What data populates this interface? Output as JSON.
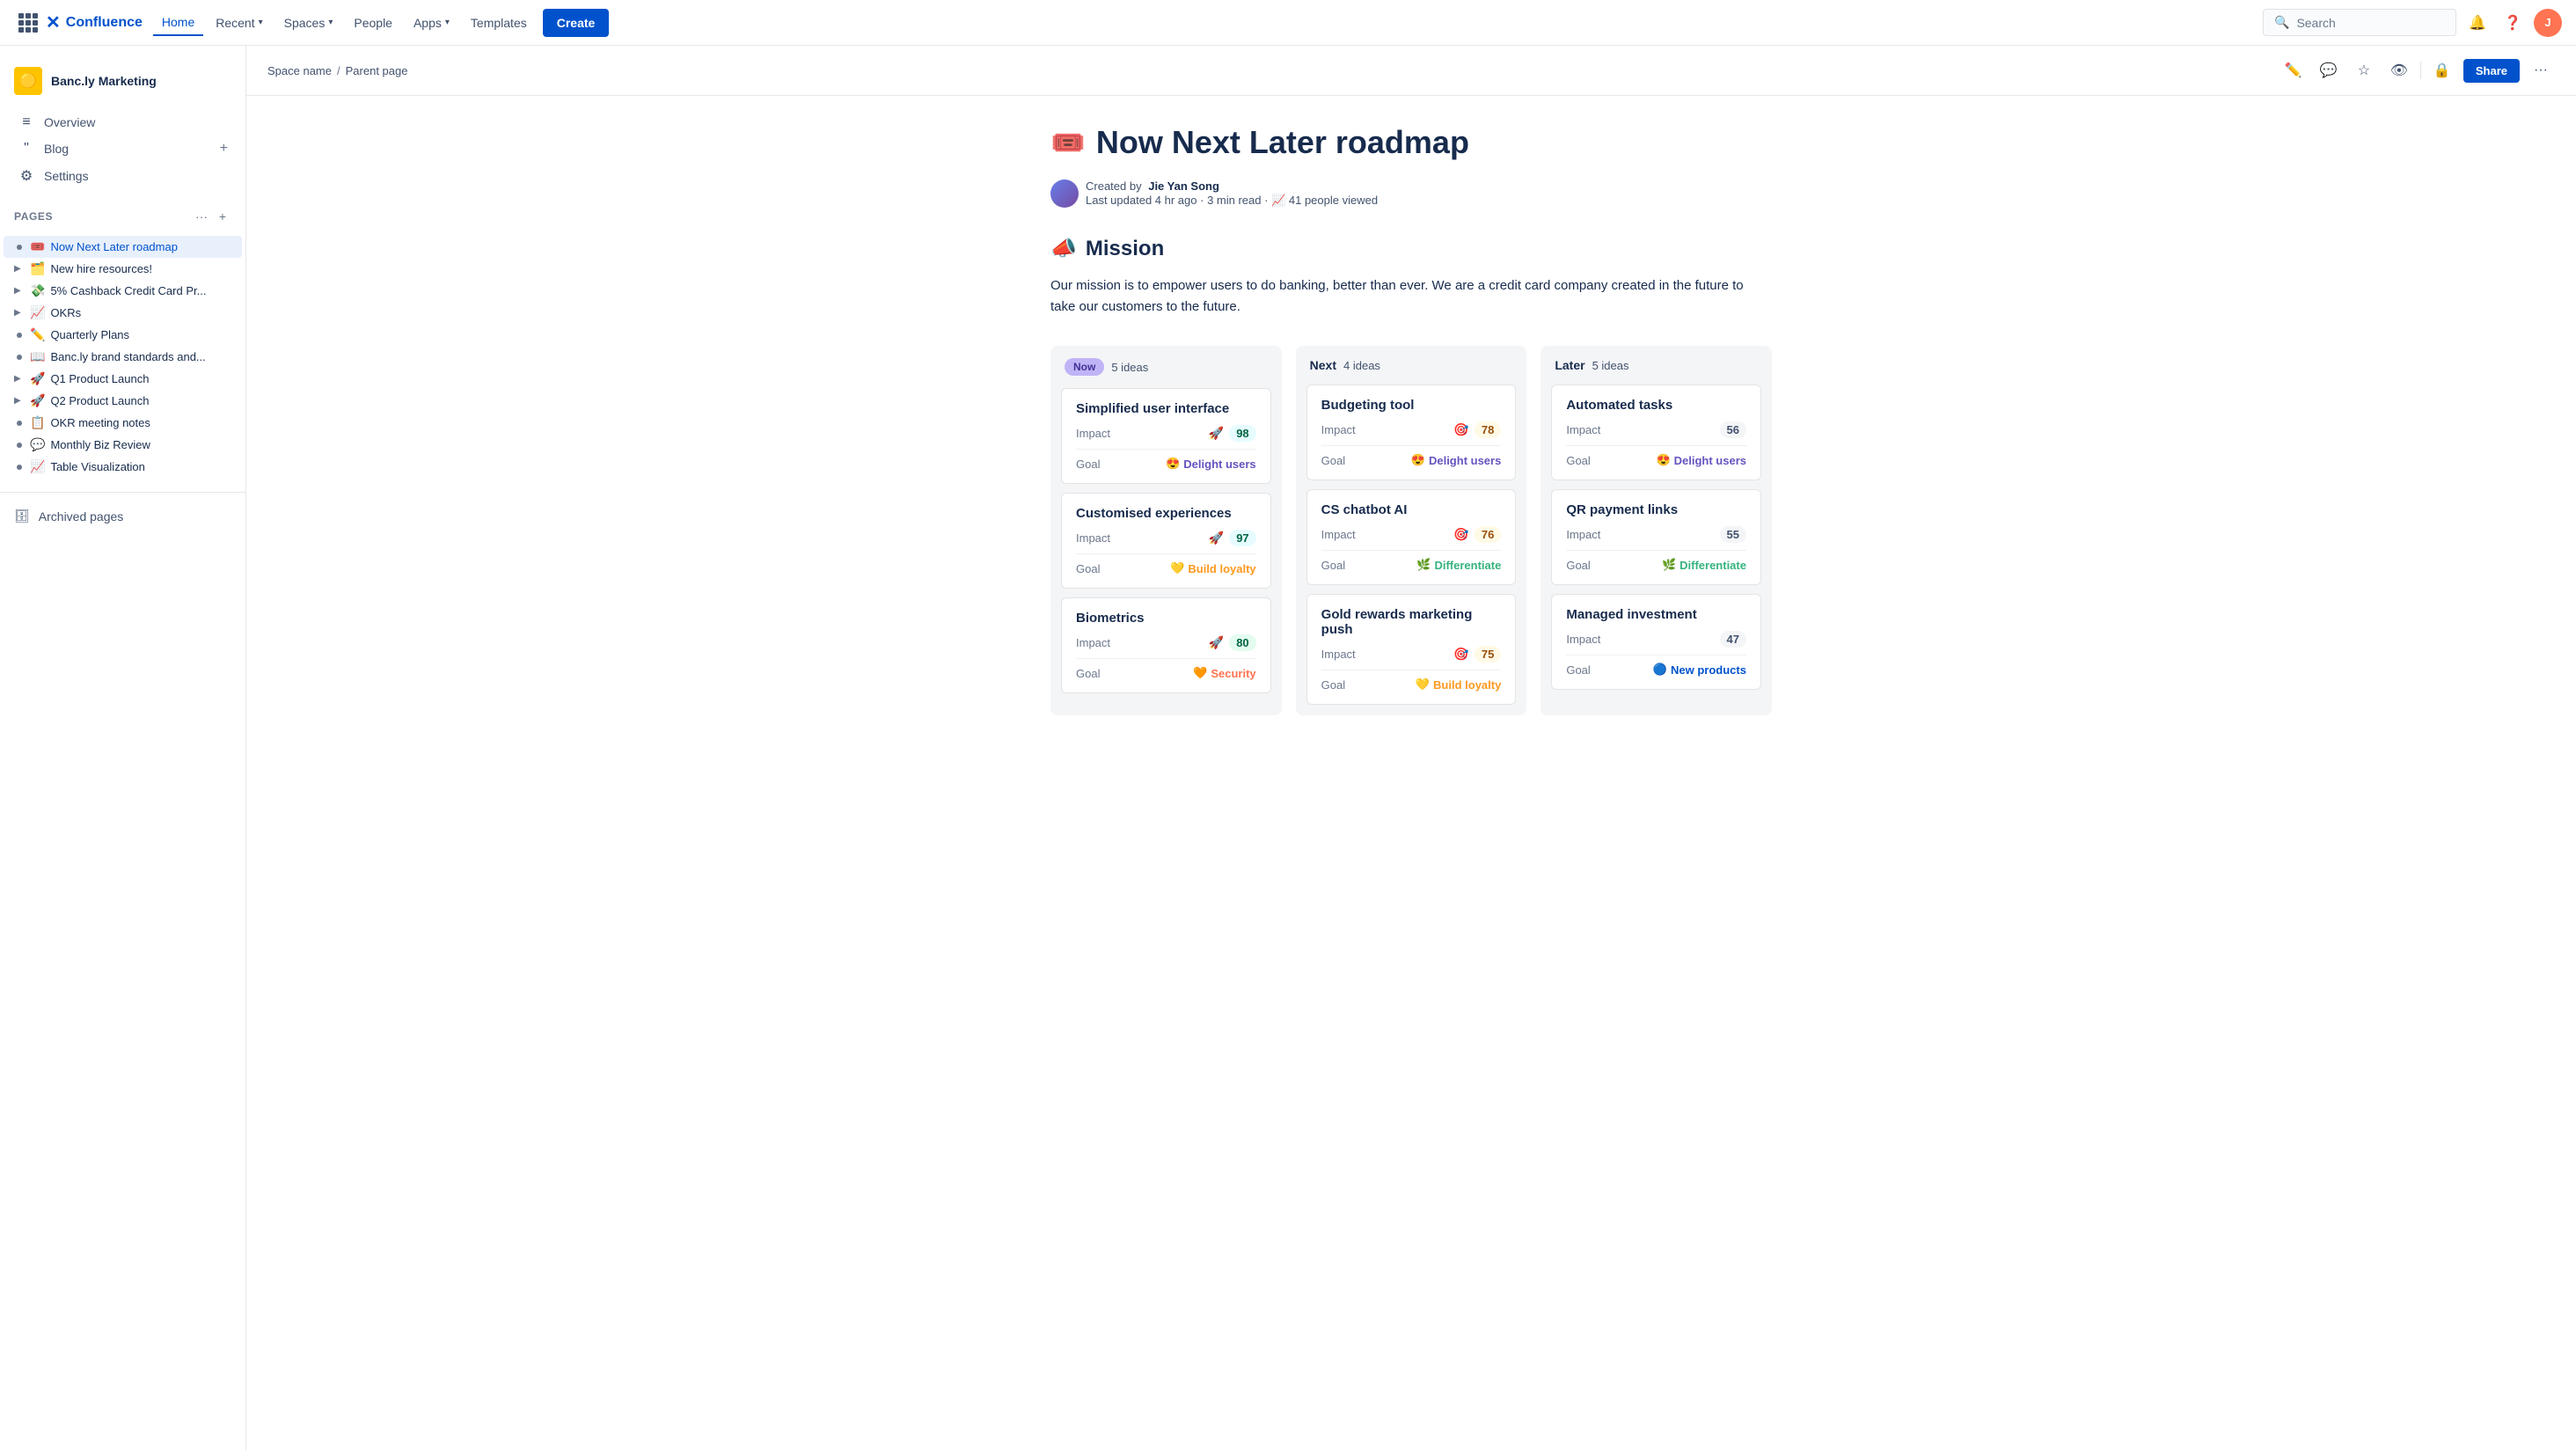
{
  "topnav": {
    "logo_text": "Confluence",
    "home_label": "Home",
    "recent_label": "Recent",
    "spaces_label": "Spaces",
    "people_label": "People",
    "apps_label": "Apps",
    "templates_label": "Templates",
    "create_label": "Create",
    "search_placeholder": "Search"
  },
  "sidebar": {
    "space_name": "Banc.ly Marketing",
    "space_emoji": "🟡",
    "nav": [
      {
        "label": "Overview",
        "icon": "≡"
      },
      {
        "label": "Blog",
        "icon": "❝"
      },
      {
        "label": "Settings",
        "icon": "⚙"
      }
    ],
    "pages_section": "Pages",
    "pages": [
      {
        "label": "Now Next Later roadmap",
        "emoji": "🎟️",
        "active": true,
        "level": 0
      },
      {
        "label": "New hire resources!",
        "emoji": "🗂️",
        "level": 0,
        "expandable": true
      },
      {
        "label": "5% Cashback Credit Card Pr...",
        "emoji": "💸",
        "level": 0,
        "expandable": true
      },
      {
        "label": "OKRs",
        "emoji": "📈",
        "level": 0,
        "expandable": true
      },
      {
        "label": "Quarterly Plans",
        "emoji": "✏️",
        "level": 0
      },
      {
        "label": "Banc.ly brand standards and...",
        "emoji": "📖",
        "level": 0
      },
      {
        "label": "Q1 Product Launch",
        "emoji": "🚀",
        "level": 0,
        "expandable": true
      },
      {
        "label": "Q2 Product Launch",
        "emoji": "🚀",
        "level": 0,
        "expandable": true
      },
      {
        "label": "OKR meeting notes",
        "emoji": "📋",
        "level": 0
      },
      {
        "label": "Monthly Biz Review",
        "emoji": "💬",
        "level": 0
      },
      {
        "label": "Table Visualization",
        "emoji": "📈",
        "level": 0
      }
    ],
    "archived_label": "Archived pages"
  },
  "breadcrumb": {
    "space": "Space name",
    "parent": "Parent page"
  },
  "page": {
    "title_emoji": "🎟️",
    "title": "Now Next Later roadmap",
    "author": "Jie Yan Song",
    "created_text": "Created by",
    "updated_text": "Last updated 4 hr ago",
    "read_time": "3 min read",
    "views": "41 people viewed",
    "mission_emoji": "📣",
    "mission_heading": "Mission",
    "mission_text": "Our mission is to empower users to do banking, better than ever. We are a credit card company created in the future to take our customers to the future."
  },
  "roadmap": {
    "columns": [
      {
        "id": "now",
        "label": "Now",
        "ideas_count": "5 ideas",
        "badge_type": "now",
        "cards": [
          {
            "title": "Simplified user interface",
            "impact_value": "98",
            "impact_emoji": "🚀",
            "impact_class": "impact-98",
            "goal_label": "Delight users",
            "goal_emoji": "😍",
            "goal_class": "delight"
          },
          {
            "title": "Customised experiences",
            "impact_value": "97",
            "impact_emoji": "🚀",
            "impact_class": "impact-97",
            "goal_label": "Build loyalty",
            "goal_emoji": "💛",
            "goal_class": "loyalty"
          },
          {
            "title": "Biometrics",
            "impact_value": "80",
            "impact_emoji": "🚀",
            "impact_class": "impact-80",
            "goal_label": "Security",
            "goal_emoji": "🧡",
            "goal_class": "security"
          }
        ]
      },
      {
        "id": "next",
        "label": "Next",
        "ideas_count": "4 ideas",
        "badge_type": "next",
        "cards": [
          {
            "title": "Budgeting tool",
            "impact_value": "78",
            "impact_emoji": "🎯",
            "impact_class": "impact-78",
            "goal_label": "Delight users",
            "goal_emoji": "😍",
            "goal_class": "delight"
          },
          {
            "title": "CS chatbot AI",
            "impact_value": "76",
            "impact_emoji": "🎯",
            "impact_class": "impact-76",
            "goal_label": "Differentiate",
            "goal_emoji": "🌿",
            "goal_class": "differentiate"
          },
          {
            "title": "Gold rewards marketing push",
            "impact_value": "75",
            "impact_emoji": "🎯",
            "impact_class": "impact-75",
            "goal_label": "Build loyalty",
            "goal_emoji": "💛",
            "goal_class": "loyalty"
          }
        ]
      },
      {
        "id": "later",
        "label": "Later",
        "ideas_count": "5 ideas",
        "badge_type": "later",
        "cards": [
          {
            "title": "Automated tasks",
            "impact_value": "56",
            "impact_emoji": "",
            "impact_class": "impact-56",
            "goal_label": "Delight users",
            "goal_emoji": "😍",
            "goal_class": "delight"
          },
          {
            "title": "QR payment links",
            "impact_value": "55",
            "impact_emoji": "",
            "impact_class": "impact-55",
            "goal_label": "Differentiate",
            "goal_emoji": "🌿",
            "goal_class": "differentiate"
          },
          {
            "title": "Managed investment",
            "impact_value": "47",
            "impact_emoji": "",
            "impact_class": "impact-47",
            "goal_label": "New products",
            "goal_emoji": "🔵",
            "goal_class": "new-products"
          }
        ]
      }
    ]
  },
  "labels": {
    "impact": "Impact",
    "goal": "Goal",
    "share": "Share"
  }
}
